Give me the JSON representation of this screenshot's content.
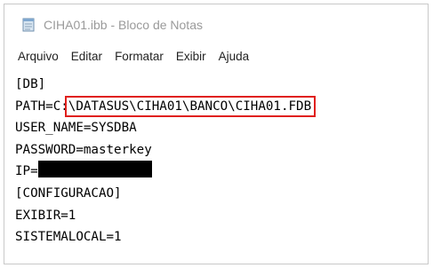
{
  "window": {
    "title": "CIHA01.ibb - Bloco de Notas",
    "app_icon": "notepad-icon"
  },
  "menu": {
    "items": [
      "Arquivo",
      "Editar",
      "Formatar",
      "Exibir",
      "Ajuda"
    ]
  },
  "editor": {
    "lines": {
      "db_section": "[DB]",
      "path_prefix": "PATH=C:",
      "path_value": "\\DATASUS\\CIHA01\\BANCO\\CIHA01.FDB",
      "user_name": "USER_NAME=SYSDBA",
      "password": "PASSWORD=masterkey",
      "ip_prefix": "IP=",
      "config_section": "[CONFIGURACAO]",
      "exibir": "EXIBIR=1",
      "sistemalocal": "SISTEMALOCAL=1"
    }
  },
  "colors": {
    "highlight_border": "#e0201c",
    "redaction": "#000000",
    "title_text": "#9a9a9a"
  }
}
